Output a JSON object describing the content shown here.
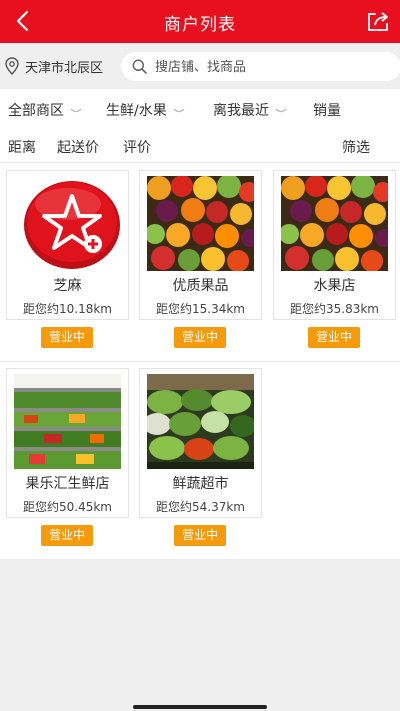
{
  "header": {
    "title": "商户列表",
    "back_icon": "back-arrow-icon",
    "share_icon": "share-icon"
  },
  "location": {
    "city": "天津市北辰区",
    "icon": "location-pin-icon"
  },
  "search": {
    "placeholder": "搜店铺、找商品",
    "value": "",
    "icon": "search-icon"
  },
  "filters": {
    "row1": [
      "全部商区",
      "生鲜/水果",
      "离我最近",
      "销量"
    ],
    "row2": [
      "距离",
      "起送价",
      "评价"
    ],
    "screen": "筛选"
  },
  "shops": [
    {
      "name": "芝麻",
      "distance": "距您约10.18km",
      "status": "营业中",
      "image": "red-star-logo"
    },
    {
      "name": "优质果品",
      "distance": "距您约15.34km",
      "status": "营业中",
      "image": "fruit-assortment"
    },
    {
      "name": "水果店",
      "distance": "距您约35.83km",
      "status": "营业中",
      "image": "fruit-assortment"
    },
    {
      "name": "果乐汇生鲜店",
      "distance": "距您约50.45km",
      "status": "营业中",
      "image": "supermarket-produce-aisle"
    },
    {
      "name": "鲜蔬超市",
      "distance": "距您约54.37km",
      "status": "营业中",
      "image": "vegetable-display"
    }
  ],
  "colors": {
    "header": "#e8101f",
    "badge": "#f59a0a"
  }
}
